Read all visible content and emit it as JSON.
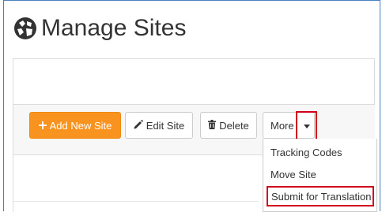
{
  "page": {
    "title": "Manage Sites",
    "title_icon": "globe-icon"
  },
  "toolbar": {
    "add_label": "Add New Site",
    "add_icon": "plus-icon",
    "edit_label": "Edit Site",
    "edit_icon": "pencil-icon",
    "delete_label": "Delete",
    "delete_icon": "trash-icon",
    "more_label": "More",
    "more_icon": "caret-down-icon"
  },
  "more_menu": {
    "items": [
      {
        "label": "Tracking Codes"
      },
      {
        "label": "Move Site"
      },
      {
        "label": "Submit for Translation"
      }
    ]
  },
  "colors": {
    "accent": "#f7931e",
    "highlight": "#d0021b",
    "frame": "#4a7fc0"
  }
}
